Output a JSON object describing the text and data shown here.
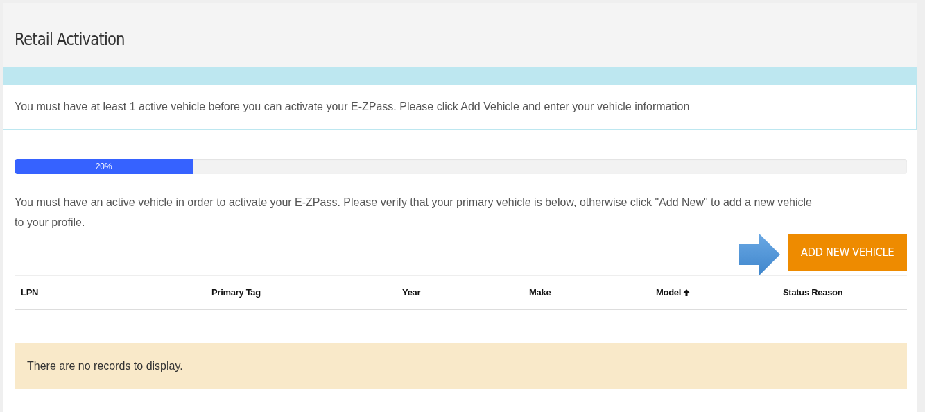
{
  "page": {
    "title": "Retail Activation"
  },
  "alert": {
    "text": "You must have at least 1 active vehicle before you can activate your E-ZPass. Please click Add Vehicle and enter your vehicle information"
  },
  "progress": {
    "level": 0.2,
    "label": "20%"
  },
  "instructions": "You must have an active vehicle in order to activate your E-ZPass. Please verify that your primary vehicle is below, otherwise click \"Add New\" to add a new vehicle to your profile.",
  "add_button": {
    "label": "ADD NEW VEHICLE"
  },
  "table": {
    "columns": [
      {
        "label": "LPN",
        "sorted_ascending": false
      },
      {
        "label": "Primary Tag",
        "sorted_ascending": false
      },
      {
        "label": "Year",
        "sorted_ascending": false
      },
      {
        "label": "Make",
        "sorted_ascending": false
      },
      {
        "label": "Model",
        "sorted_ascending": true
      },
      {
        "label": "Status Reason",
        "sorted_ascending": false
      }
    ],
    "empty_message": "There are no records to display."
  }
}
